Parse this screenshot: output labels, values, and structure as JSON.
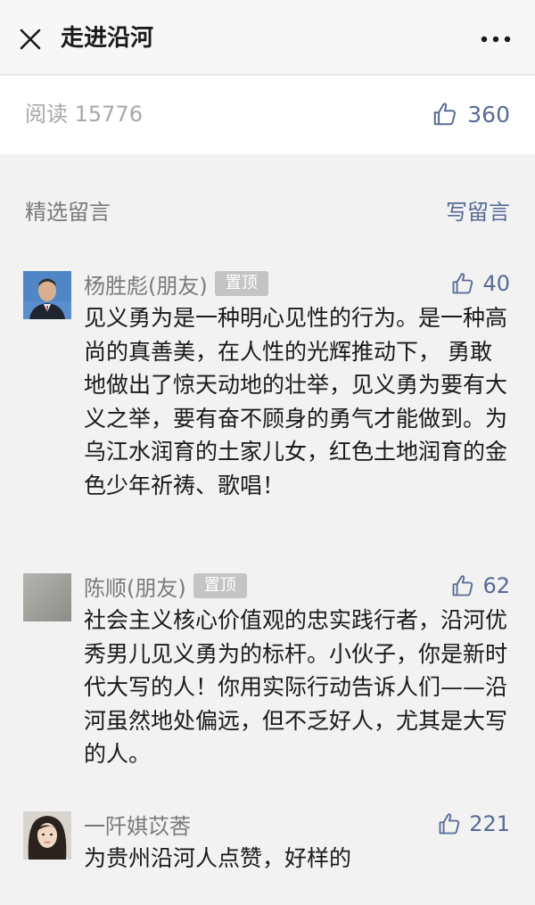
{
  "header": {
    "title": "走进沿河",
    "close_icon": "close-icon",
    "more_icon": "more-dots-icon"
  },
  "stats": {
    "read_label": "阅读 15776",
    "like_count": "360",
    "like_icon": "thumbs-up-icon"
  },
  "comments_section": {
    "title": "精选留言",
    "write_label": "写留言"
  },
  "comments": [
    {
      "nickname": "杨胜彪(朋友)",
      "pinned_label": "置顶",
      "likes": "40",
      "text": "见义勇为是一种明心见性的行为。是一种高尚的真善美，在人性的光辉推动下， 勇敢地做出了惊天动地的壮举，见义勇为要有大义之举，要有奋不顾身的勇气才能做到。为乌江水润育的土家儿女，红色土地润育的金色少年祈祷、歌唱！"
    },
    {
      "nickname": "陈顺(朋友)",
      "pinned_label": "置顶",
      "likes": "62",
      "text": "社会主义核心价值观的忠实践行者，沿河优秀男儿见义勇为的标杆。小伙子，你是新时代大写的人！你用实际行动告诉人们——沿河虽然地处偏远，但不乏好人，尤其是大写的人。"
    },
    {
      "nickname": "一阡娸苡莕",
      "likes": "221",
      "text": "为贵州沿河人点赞，好样的"
    }
  ],
  "colors": {
    "link": "#576b95",
    "muted": "#a8a8a8",
    "background": "#f2f2f2",
    "pin_bg": "#c4c4c4"
  }
}
